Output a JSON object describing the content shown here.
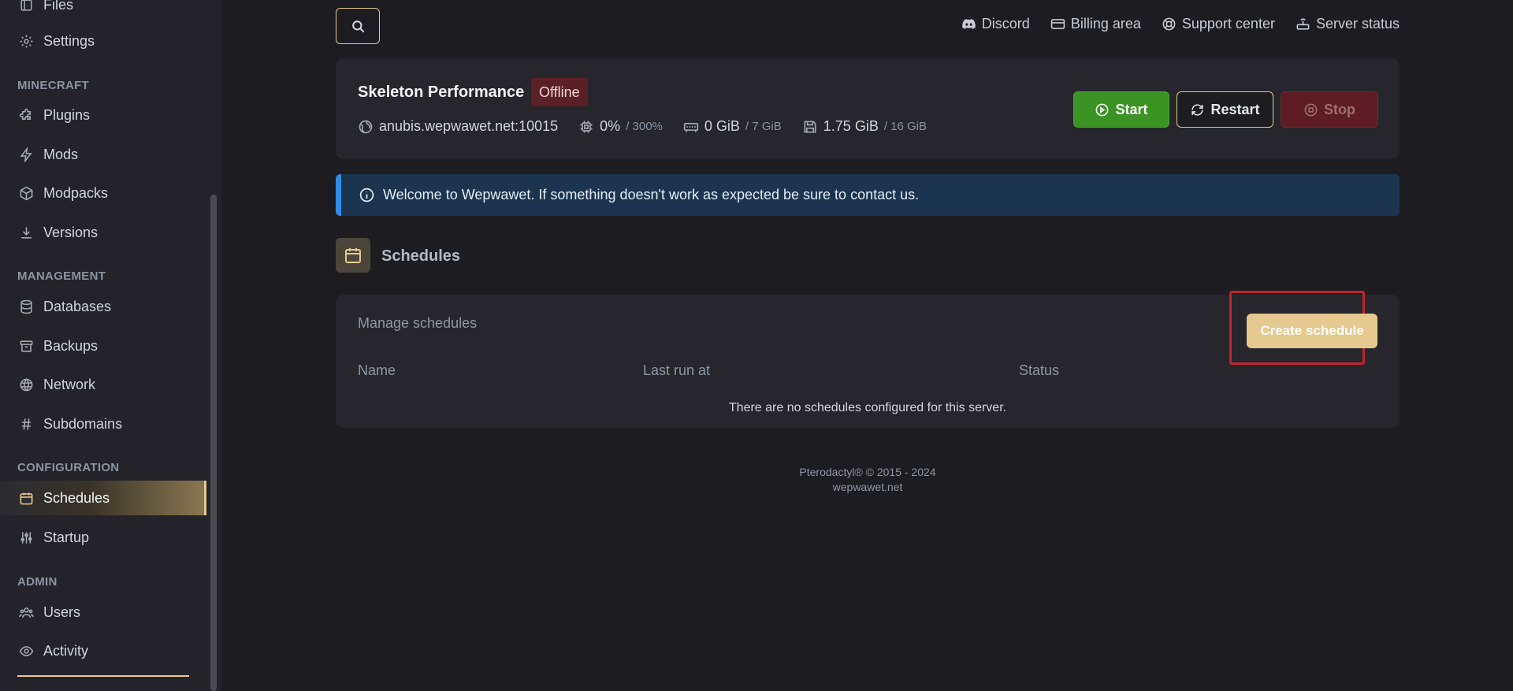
{
  "sidebar": {
    "top_items": [
      {
        "label": "Files",
        "icon": "file-icon"
      },
      {
        "label": "Settings",
        "icon": "gear-icon"
      }
    ],
    "sections": [
      {
        "title": "MINECRAFT",
        "items": [
          {
            "label": "Plugins",
            "icon": "puzzle-icon"
          },
          {
            "label": "Mods",
            "icon": "bolt-icon"
          },
          {
            "label": "Modpacks",
            "icon": "cube-icon"
          },
          {
            "label": "Versions",
            "icon": "download-icon"
          }
        ]
      },
      {
        "title": "MANAGEMENT",
        "items": [
          {
            "label": "Databases",
            "icon": "database-icon"
          },
          {
            "label": "Backups",
            "icon": "archive-icon"
          },
          {
            "label": "Network",
            "icon": "globe-icon"
          },
          {
            "label": "Subdomains",
            "icon": "hash-icon"
          }
        ]
      },
      {
        "title": "CONFIGURATION",
        "items": [
          {
            "label": "Schedules",
            "icon": "calendar-icon",
            "active": true
          },
          {
            "label": "Startup",
            "icon": "sliders-icon"
          }
        ]
      },
      {
        "title": "ADMIN",
        "items": [
          {
            "label": "Users",
            "icon": "users-icon"
          },
          {
            "label": "Activity",
            "icon": "eye-icon"
          }
        ]
      }
    ]
  },
  "topbar": {
    "links": [
      {
        "label": "Discord",
        "icon": "discord-icon"
      },
      {
        "label": "Billing area",
        "icon": "credit-card-icon"
      },
      {
        "label": "Support center",
        "icon": "lifebuoy-icon"
      },
      {
        "label": "Server status",
        "icon": "router-icon"
      }
    ]
  },
  "server": {
    "name": "Skeleton Performance",
    "status": "Offline",
    "address": "anubis.wepwawet.net:10015",
    "cpu": {
      "value": "0%",
      "limit": "/ 300%"
    },
    "memory": {
      "value": "0 GiB",
      "limit": "/ 7 GiB"
    },
    "disk": {
      "value": "1.75 GiB",
      "limit": "/ 16 GiB"
    },
    "buttons": {
      "start": "Start",
      "restart": "Restart",
      "stop": "Stop"
    }
  },
  "alert": {
    "text": "Welcome to Wepwawet. If something doesn't work as expected be sure to contact us."
  },
  "page": {
    "title": "Schedules"
  },
  "schedules": {
    "subtitle": "Manage schedules",
    "create_label": "Create schedule",
    "columns": [
      "Name",
      "Last run at",
      "Status"
    ],
    "empty_text": "There are no schedules configured for this server."
  },
  "footer": {
    "copyright": "Pterodactyl® © 2015 - 2024",
    "site": "wepwawet.net"
  },
  "colors": {
    "accent": "#e6c98f",
    "start": "#3a9323",
    "stop": "#5e1d24",
    "alert": "#1b3550",
    "highlight": "#c0242f"
  }
}
